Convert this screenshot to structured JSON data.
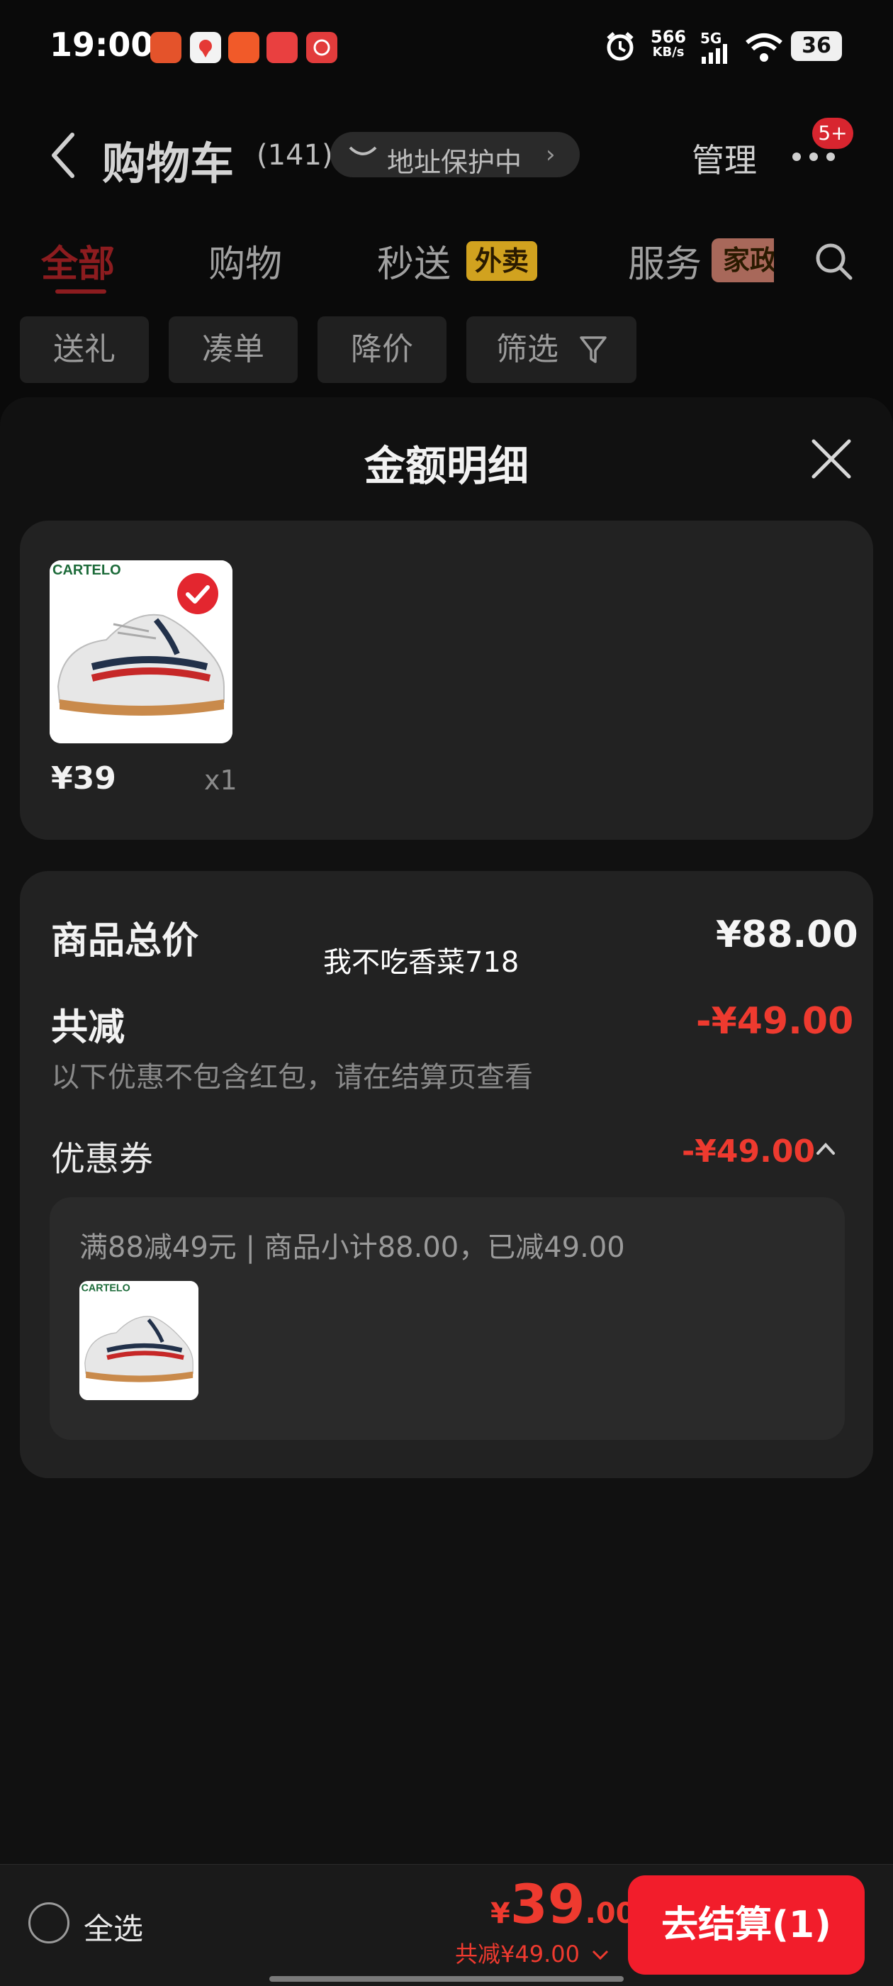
{
  "status_bar": {
    "time": "19:00",
    "net_speed": "566",
    "net_unit": "KB/s",
    "signal": "5G",
    "battery": "36",
    "app_icons": [
      "app-icon-red",
      "app-icon-map",
      "app-icon-orange",
      "app-icon-game",
      "app-icon-star"
    ]
  },
  "header": {
    "title": "购物车",
    "count": "(141)",
    "address_protect": "地址保护中",
    "manage": "管理",
    "badge": "5+"
  },
  "tabs": [
    {
      "label": "全部"
    },
    {
      "label": "购物"
    },
    {
      "label": "秒送",
      "tag": "外卖"
    },
    {
      "label": "服务",
      "tag": "家政"
    }
  ],
  "chips": [
    {
      "label": "送礼"
    },
    {
      "label": "凑单"
    },
    {
      "label": "降价"
    },
    {
      "label": "筛选"
    }
  ],
  "sheet": {
    "title": "金额明细",
    "item": {
      "brand": "CARTELO",
      "price": "¥39",
      "qty": "x1"
    },
    "total_label": "商品总价",
    "total_value": "¥88.00",
    "watermark": "我不吃香菜718",
    "discount_label": "共减",
    "discount_value": "-¥49.00",
    "discount_note": "以下优惠不包含红包，请在结算页查看",
    "coupon_label": "优惠券",
    "coupon_value": "-¥49.00",
    "coupon_detail": "满88减49元 | 商品小计88.00，已减49.00"
  },
  "bottom": {
    "select_all": "全选",
    "yen": "¥",
    "total_int": "39",
    "total_dec": ".00",
    "saved": "共减¥49.00",
    "checkout": "去结算(1)"
  },
  "colors": {
    "accent_red": "#ee3a2f",
    "button_red": "#f21d2b",
    "tab_active": "#8c1c1f",
    "tag_gold": "#d1a21f"
  }
}
